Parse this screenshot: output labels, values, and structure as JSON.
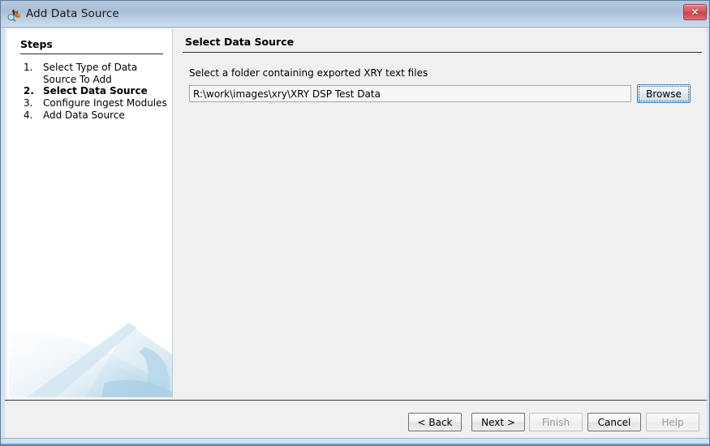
{
  "window": {
    "title": "Add Data Source",
    "app_icon": "autopsy-dog-icon",
    "close_label": "✕",
    "accent_color": "#3c7fb1",
    "titlebar_color": "#a8bdd6",
    "panel_color": "#f0f0f0",
    "close_button_color": "#d9565c"
  },
  "steps": {
    "heading": "Steps",
    "items": [
      {
        "number": "1.",
        "label": "Select Type of Data Source To Add",
        "current": false
      },
      {
        "number": "2.",
        "label": "Select Data Source",
        "current": true
      },
      {
        "number": "3.",
        "label": "Configure Ingest Modules",
        "current": false
      },
      {
        "number": "4.",
        "label": "Add Data Source",
        "current": false
      }
    ]
  },
  "main": {
    "title": "Select Data Source",
    "field_label": "Select a folder containing exported XRY text files",
    "path_value": "R:\\work\\images\\xry\\XRY DSP Test Data",
    "path_placeholder": "",
    "browse_label": "Browse"
  },
  "buttons": {
    "back": {
      "label": "< Back",
      "enabled": true
    },
    "next": {
      "label": "Next >",
      "enabled": true
    },
    "finish": {
      "label": "Finish",
      "enabled": false
    },
    "cancel": {
      "label": "Cancel",
      "enabled": true
    },
    "help": {
      "label": "Help",
      "enabled": false
    }
  }
}
